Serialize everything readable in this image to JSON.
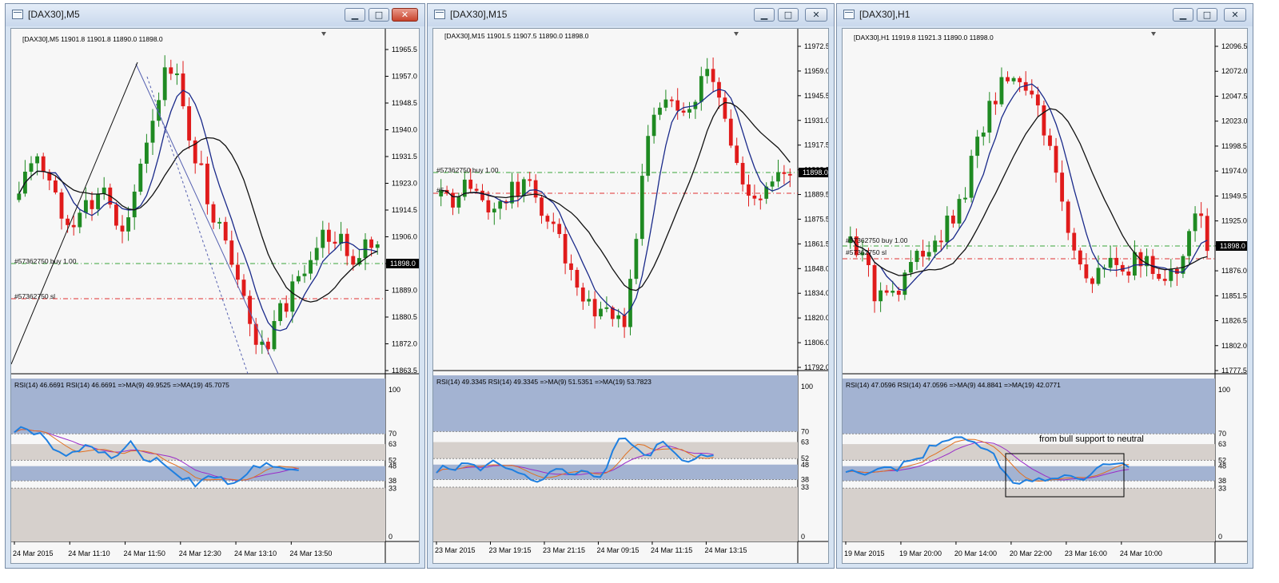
{
  "windows": [
    {
      "title": "[DAX30],M5",
      "header": "[DAX30],M5  11901.8 11901.8 11890.0 11898.0",
      "price_axis": [
        "11965.5",
        "11957.0",
        "11948.5",
        "11940.0",
        "11931.5",
        "11923.0",
        "11914.5",
        "11906.0",
        "11897.5",
        "11889.0",
        "11880.5",
        "11872.0",
        "11863.5"
      ],
      "current_price": "11898.0",
      "orders": [
        "#57362750 buy 1.00",
        "#57362750 sl"
      ],
      "rsi_label": "RSI(14) 46.6691  RSI(14) 46.6691  =>MA(9) 49.9525  =>MA(19) 45.7075",
      "rsi_axis": [
        "100",
        "70",
        "63",
        "52",
        "48",
        "38",
        "33",
        "0"
      ],
      "time_axis": [
        "24 Mar 2015",
        "24 Mar 11:10",
        "24 Mar 11:50",
        "24 Mar 12:30",
        "24 Mar 13:10",
        "24 Mar 13:50"
      ],
      "annotation": ""
    },
    {
      "title": "[DAX30],M15",
      "header": "[DAX30],M15  11901.5 11907.5 11890.0 11898.0",
      "price_axis": [
        "11972.5",
        "11959.0",
        "11945.5",
        "11931.0",
        "11917.5",
        "11903.5",
        "11889.5",
        "11875.5",
        "11861.5",
        "11848.0",
        "11834.0",
        "11820.0",
        "11806.0",
        "11792.0"
      ],
      "current_price": "11898.0",
      "orders": [
        "#57362750 buy 1.00",
        "#5"
      ],
      "rsi_label": "RSI(14) 49.3345  RSI(14) 49.3345  =>MA(9) 51.5351  =>MA(19) 53.7823",
      "rsi_axis": [
        "100",
        "70",
        "63",
        "52",
        "48",
        "38",
        "33",
        "0"
      ],
      "time_axis": [
        "23 Mar 2015",
        "23 Mar 19:15",
        "23 Mar 21:15",
        "24 Mar 09:15",
        "24 Mar 11:15",
        "24 Mar 13:15"
      ],
      "annotation": ""
    },
    {
      "title": "[DAX30],H1",
      "header": "[DAX30],H1  11919.8 11921.3 11890.0 11898.0",
      "price_axis": [
        "12096.5",
        "12072.0",
        "12047.5",
        "12023.0",
        "11998.5",
        "11974.0",
        "11949.5",
        "11925.0",
        "11900.5",
        "11876.0",
        "11851.5",
        "11826.5",
        "11802.0",
        "11777.5"
      ],
      "current_price": "11898.0",
      "orders": [
        "#57362750 buy 1.00",
        "#57362750 sl"
      ],
      "rsi_label": "RSI(14) 47.0596  RSI(14) 47.0596  =>MA(9) 44.8841  =>MA(19) 42.0771",
      "rsi_axis": [
        "100",
        "70",
        "63",
        "52",
        "48",
        "38",
        "33",
        "0"
      ],
      "time_axis": [
        "19 Mar 2015",
        "19 Mar 20:00",
        "20 Mar 14:00",
        "20 Mar 22:00",
        "23 Mar 16:00",
        "24 Mar 10:00"
      ],
      "annotation": "from bull support to neutral"
    }
  ],
  "colors": {
    "bull": "#1f8a22",
    "bear": "#e01b1b",
    "rsi_line": "#1e7fe0",
    "ma_fast": "#e07020",
    "ma_slow": "#9a2cc8",
    "band": "#a3b3d2",
    "band_grey": "#d6d0cc"
  }
}
